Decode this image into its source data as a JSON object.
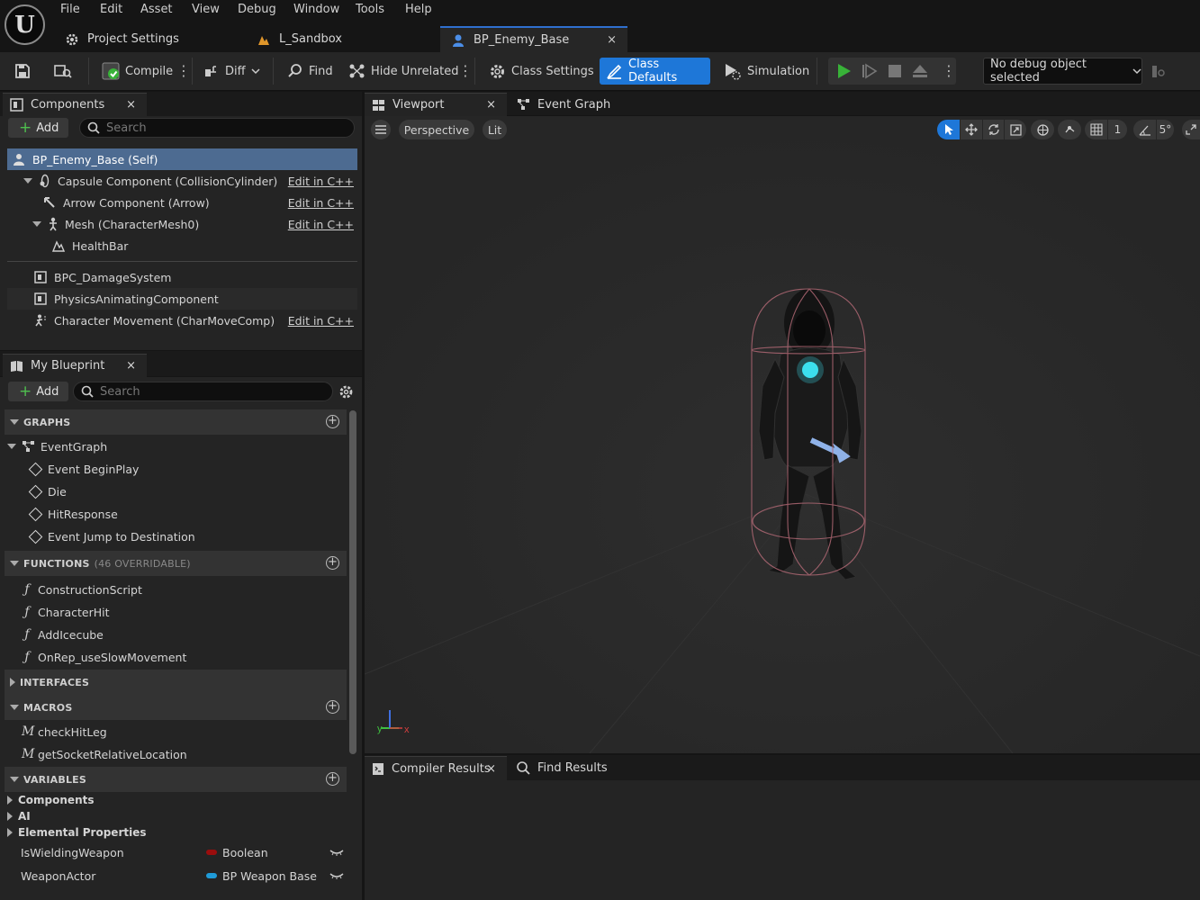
{
  "menu": [
    "File",
    "Edit",
    "Asset",
    "View",
    "Debug",
    "Window",
    "Tools",
    "Help"
  ],
  "doc_tabs": [
    {
      "label": "Project Settings",
      "icon": "gear-icon"
    },
    {
      "label": "L_Sandbox",
      "icon": "level-icon"
    },
    {
      "label": "BP_Enemy_Base",
      "icon": "blueprint-actor-icon",
      "close": "×"
    }
  ],
  "toolbar": {
    "compile": "Compile",
    "diff": "Diff",
    "find": "Find",
    "hide_unrelated": "Hide Unrelated",
    "class_settings": "Class Settings",
    "class_defaults": "Class Defaults",
    "simulation": "Simulation",
    "debug_object": "No debug object selected"
  },
  "components_panel": {
    "tab": "Components",
    "close": "×",
    "add": "Add",
    "search_placeholder": "Search",
    "edit_cpp": "Edit in C++",
    "items": [
      {
        "label": "BP_Enemy_Base (Self)"
      },
      {
        "label": "Capsule Component (CollisionCylinder)"
      },
      {
        "label": "Arrow Component (Arrow)"
      },
      {
        "label": "Mesh (CharacterMesh0)"
      },
      {
        "label": "HealthBar"
      },
      {
        "label": "BPC_DamageSystem"
      },
      {
        "label": "PhysicsAnimatingComponent"
      },
      {
        "label": "Character Movement (CharMoveComp)"
      }
    ]
  },
  "my_blueprint": {
    "tab": "My Blueprint",
    "close": "×",
    "add": "Add",
    "search_placeholder": "Search",
    "sections": {
      "graphs": "GRAPHS",
      "functions": "FUNCTIONS",
      "functions_note": "(46 OVERRIDABLE)",
      "interfaces": "INTERFACES",
      "macros": "MACROS",
      "variables": "VARIABLES"
    },
    "graphs": [
      "EventGraph",
      "Event BeginPlay",
      "Die",
      "HitResponse",
      "Event Jump to Destination"
    ],
    "functions": [
      "ConstructionScript",
      "CharacterHit",
      "AddIcecube",
      "OnRep_useSlowMovement"
    ],
    "macros": [
      "checkHitLeg",
      "getSocketRelativeLocation"
    ],
    "var_groups": [
      "Components",
      "AI",
      "Elemental Properties"
    ],
    "variables": [
      {
        "name": "IsWieldingWeapon",
        "type": "Boolean",
        "color": "#9b0d0d"
      },
      {
        "name": "WeaponActor",
        "type": "BP Weapon Base",
        "color": "#1f9bd8"
      }
    ]
  },
  "viewport": {
    "tab": "Viewport",
    "close": "×",
    "graph_tab": "Event Graph",
    "perspective": "Perspective",
    "lit": "Lit",
    "grid_value": "1",
    "angle_value": "5°",
    "axis_y": "y",
    "axis_x": "x"
  },
  "bottom": {
    "compiler_results": "Compiler Results",
    "close": "×",
    "find_results": "Find Results"
  },
  "colors": {
    "accent": "#1e77d8",
    "selection": "#4d6b91",
    "play": "#38b238"
  }
}
